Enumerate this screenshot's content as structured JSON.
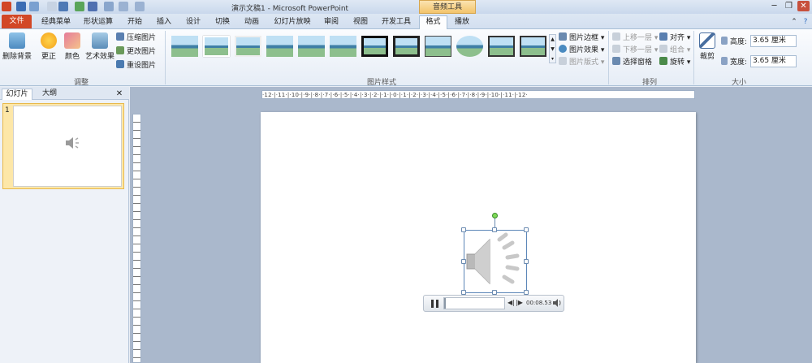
{
  "titlebar": {
    "title": "演示文稿1 - Microsoft PowerPoint",
    "context_tool": "音频工具"
  },
  "tabs": [
    "文件",
    "经典菜单",
    "形状运算",
    "开始",
    "插入",
    "设计",
    "切换",
    "动画",
    "幻灯片放映",
    "审阅",
    "视图",
    "开发工具",
    "格式",
    "播放"
  ],
  "ribbon": {
    "adjust": {
      "remove_bg": "删除背景",
      "corrections": "更正",
      "color": "颜色",
      "artistic": "艺术效果",
      "compress": "压缩图片",
      "change": "更改图片",
      "reset": "重设图片",
      "label": "调整"
    },
    "styles": {
      "label": "图片样式",
      "border": "图片边框",
      "effects": "图片效果",
      "layout": "图片版式"
    },
    "arrange": {
      "bring_forward": "上移一层",
      "send_backward": "下移一层",
      "selection_pane": "选择窗格",
      "align": "对齐",
      "group": "组合",
      "rotate": "旋转",
      "label": "排列"
    },
    "size": {
      "crop": "裁剪",
      "height_label": "高度:",
      "height_value": "3.65 厘米",
      "width_label": "宽度:",
      "width_value": "3.65 厘米",
      "label": "大小"
    }
  },
  "panel": {
    "tab_slides": "幻灯片",
    "tab_outline": "大纲",
    "slide_number": "1",
    "close": "✕"
  },
  "ruler": {
    "h": "·12·|·11·|·10·|·9·|·8·|·7·|·6·|·5·|·4·|·3·|·2·|·1·|·0·|·1·|·2·|·3·|·4·|·5·|·6·|·7·|·8·|·9·|·10·|·11·|·12·"
  },
  "player": {
    "time": "00:08.53",
    "progress": 0.03
  },
  "colors": {
    "file_tab": "#d24726",
    "context": "#f3c46b",
    "accent": "#5b86b8"
  }
}
